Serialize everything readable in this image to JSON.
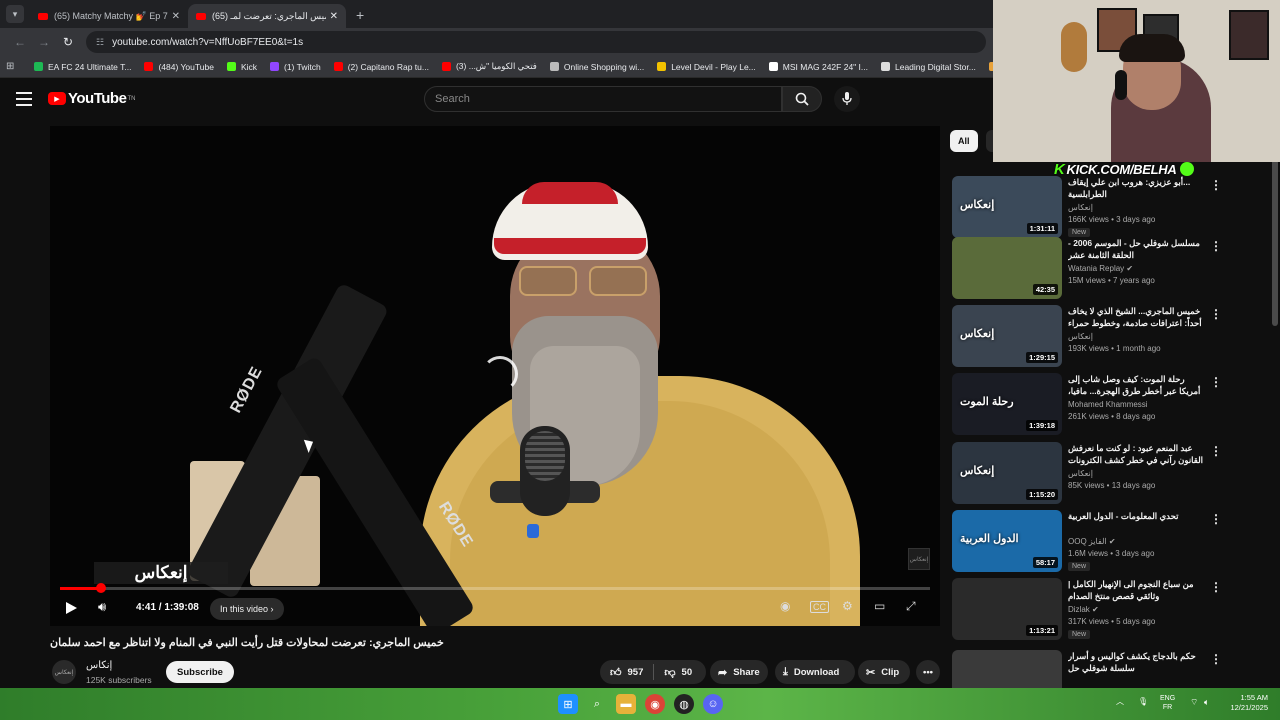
{
  "browser": {
    "tabs": [
      {
        "title": "(65) Matchy Matchy 💅 Ep 72:",
        "active": false
      },
      {
        "title": "(65) خميس الماجري: تعرضت لمـ",
        "active": true
      }
    ],
    "url": "youtube.com/watch?v=NffUoBF7EE0&t=1s",
    "bookmarks": [
      {
        "label": "EA FC 24 Ultimate T...",
        "color": "#1db954"
      },
      {
        "label": "(484) YouTube",
        "color": "#ff0000"
      },
      {
        "label": "Kick",
        "color": "#53fc18"
      },
      {
        "label": "(1) Twitch",
        "color": "#9146ff"
      },
      {
        "label": "(2) Capitano Rap tu...",
        "color": "#ff0000"
      },
      {
        "label": "فتحي الكوميا \"ش... (3)",
        "color": "#ff0000"
      },
      {
        "label": "Online Shopping wi...",
        "color": "#bbbbbb"
      },
      {
        "label": "Level Devil - Play Le...",
        "color": "#f2c200"
      },
      {
        "label": "MSI MAG 242F 24\" I...",
        "color": "#ffffff"
      },
      {
        "label": "Leading Digital Stor...",
        "color": "#dddddd"
      },
      {
        "label": "Buy Playstatio",
        "color": "#e8a23a"
      }
    ]
  },
  "youtube": {
    "logo_text": "YouTube",
    "logo_tm": "TN",
    "search_placeholder": "Search"
  },
  "player": {
    "watermark": "إنعكاس",
    "rode_left": "RØDE",
    "rode_right": "RØDE",
    "corner_badge": "إنعكاس",
    "progress": 0.047,
    "time": "4:41 / 1:39:08",
    "chapter_label": "In this video"
  },
  "video": {
    "title": "خميس الماجري: تعرضت لمحاولات قتل رأيت النبي في المنام ولا اتناظر مع احمد سلمان",
    "channel": "إنكاس",
    "avatar_text": "إنعكاس",
    "subscribers": "125K subscribers",
    "subscribe_label": "Subscribe",
    "likes": "957",
    "dislikes": "50",
    "share_label": "Share",
    "download_label": "Download",
    "clip_label": "Clip"
  },
  "sidebar": {
    "chips": [
      "All",
      "F"
    ],
    "recommendations": [
      {
        "title": "...أبو عزيزي: هروب ابن علي إيقاف الطرابلسية",
        "channel": "إنعكاس",
        "meta": "166K views • 3 days ago",
        "badge": "New",
        "duration": "1:31:11",
        "thumb_label": "إنعكاس",
        "thumb_color": "#3b4a5a"
      },
      {
        "title": "مسلسل شوفلي حل - الموسم 2006 - الحلقة الثامنة عشر",
        "channel": "Watania Replay ✔",
        "meta": "15M views • 7 years ago",
        "badge": "",
        "duration": "42:35",
        "thumb_label": "",
        "thumb_color": "#5a6b3a"
      },
      {
        "title": "خميس الماجري... الشيخ الذي لا يخاف أحداً: اعترافات صادمة، وخطوط حمراء يكسرها...",
        "channel": "إنعكاس",
        "meta": "193K views • 1 month ago",
        "badge": "",
        "duration": "1:29:15",
        "thumb_label": "إنعكاس",
        "thumb_color": "#3a4450"
      },
      {
        "title": "رحلة الموت: كيف وصل شاب إلى أمريكا عبر أخطر طرق الهجرة... مافيا، عصابات...",
        "channel": "Mohamed Khammessi",
        "meta": "261K views • 8 days ago",
        "badge": "",
        "duration": "1:39:18",
        "thumb_label": "رحلة الموت",
        "thumb_color": "#1a1c24"
      },
      {
        "title": "عبد المنعم عبود : لو كنت ما نعرفش القانون رآني في خطر كشف الكترونات كيف تتعامل مع",
        "channel": "إنعكاس",
        "meta": "85K views • 13 days ago",
        "badge": "",
        "duration": "1:15:20",
        "thumb_label": "إنعكاس",
        "thumb_color": "#2c3540"
      },
      {
        "title": "تحدي المعلومات - الدول العربية",
        "channel": "OOQ الفايز ✔",
        "meta": "1.6M views • 3 days ago",
        "badge": "New",
        "duration": "58:17",
        "thumb_label": "الدول العربية",
        "thumb_color": "#1b6aa8"
      },
      {
        "title": "من سباع النجوم الى الإنهيار الكامل | وثائقي قصص منتخ الصدام",
        "channel": "Dizlak ✔",
        "meta": "317K views • 5 days ago",
        "badge": "New",
        "duration": "1:13:21",
        "thumb_label": "",
        "thumb_color": "#2a2a2a"
      },
      {
        "title": "حكم بالدجاج يكشف كواليس و أسرار سلسلة شوفلي حل",
        "channel": "",
        "meta": "",
        "badge": "",
        "duration": "",
        "thumb_label": "",
        "thumb_color": "#3a3a3a"
      }
    ]
  },
  "overlay": {
    "kick_text": "KICK.COM/BELHA"
  },
  "taskbar": {
    "lang_line1": "ENG",
    "lang_line2": "FR",
    "time": "1:55 AM",
    "date": "12/21/2025"
  }
}
